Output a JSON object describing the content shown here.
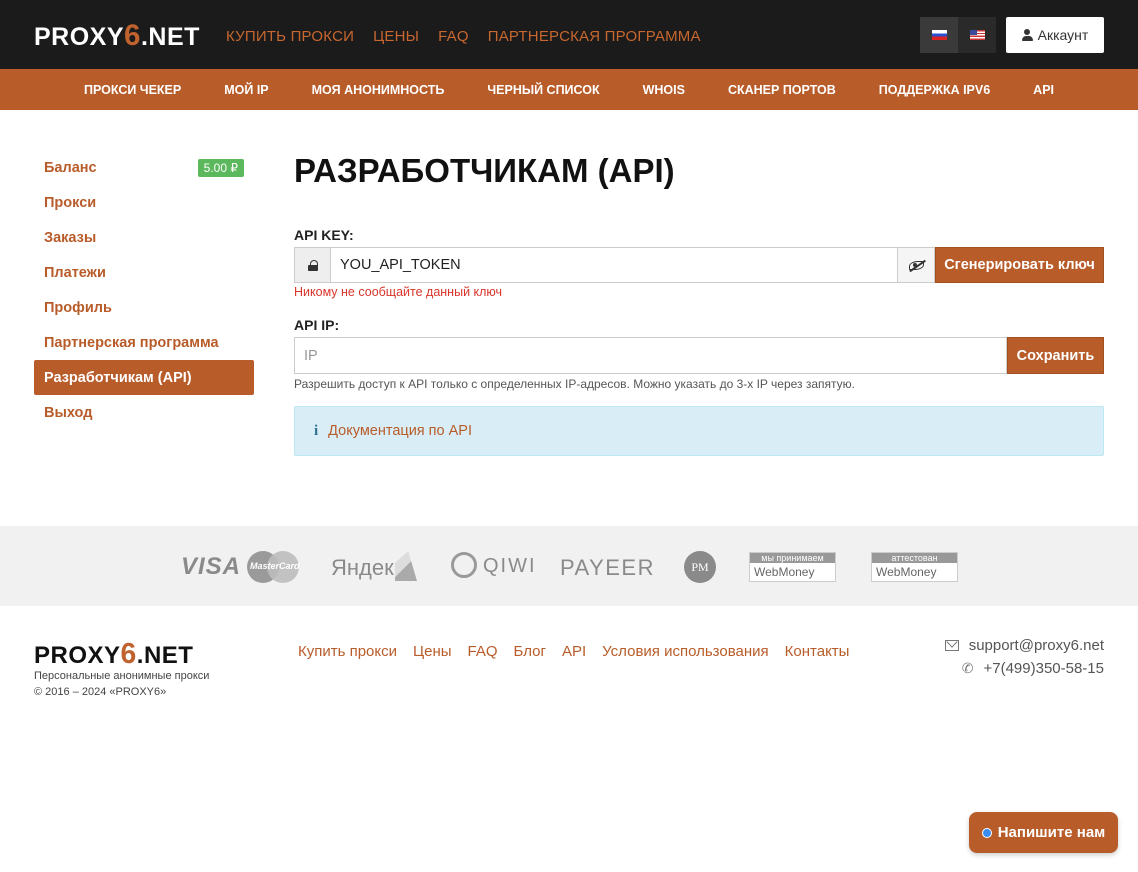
{
  "header": {
    "logo": {
      "prefix": "PROXY",
      "six": "6",
      "suffix": ".NET"
    },
    "nav": [
      "КУПИТЬ ПРОКСИ",
      "ЦЕНЫ",
      "FAQ",
      "ПАРТНЕРСКАЯ ПРОГРАММА"
    ],
    "account_label": "Аккаунт"
  },
  "subnav": [
    "ПРОКСИ ЧЕКЕР",
    "МОЙ IP",
    "МОЯ АНОНИМНОСТЬ",
    "ЧЕРНЫЙ СПИСОК",
    "WHOIS",
    "СКАНЕР ПОРТОВ",
    "ПОДДЕРЖКА IPV6",
    "API"
  ],
  "sidebar": {
    "items": [
      {
        "label": "Баланс",
        "badge": "5.00 ₽"
      },
      {
        "label": "Прокси"
      },
      {
        "label": "Заказы"
      },
      {
        "label": "Платежи"
      },
      {
        "label": "Профиль"
      },
      {
        "label": "Партнерская программа"
      },
      {
        "label": "Разработчикам (API)",
        "active": true
      },
      {
        "label": "Выход"
      }
    ]
  },
  "main": {
    "title": "РАЗРАБОТЧИКАМ (API)",
    "api_key": {
      "label": "API KEY:",
      "value": "YOU_API_TOKEN",
      "generate_label": "Сгенерировать ключ",
      "warning": "Никому не сообщайте данный ключ"
    },
    "api_ip": {
      "label": "API IP:",
      "placeholder": "IP",
      "value": "",
      "save_label": "Сохранить",
      "help": "Разрешить доступ к API только с определенных IP-адресов. Можно указать до 3-х IP через запятую."
    },
    "docs_link": "Документация по API"
  },
  "payments": {
    "visa": "VISA",
    "mastercard": "MasterCard",
    "yandex": "Яндекс",
    "qiwi": "QIWI",
    "payeer": "PAYEER",
    "pm": "PM",
    "webmoney_accept": {
      "top": "мы принимаем",
      "bottom": "WebMoney"
    },
    "webmoney_attested": {
      "top": "аттестован",
      "bottom": "WebMoney"
    }
  },
  "footer": {
    "logo": {
      "prefix": "PROXY",
      "six": "6",
      "suffix": ".NET"
    },
    "tagline": "Персональные анонимные прокси",
    "copyright": "© 2016 – 2024 «PROXY6»",
    "nav": [
      "Купить прокси",
      "Цены",
      "FAQ",
      "Блог",
      "API",
      "Условия использования",
      "Контакты"
    ],
    "email": "support@proxy6.net",
    "phone": "+7(499)350-58-15"
  },
  "chat": {
    "label": "Напишите нам"
  },
  "colors": {
    "accent": "#b85c2a",
    "header_bg": "#1b1b1b",
    "badge": "#5cb85c",
    "warning": "#d9352b",
    "info_bg": "#d9edf7"
  }
}
